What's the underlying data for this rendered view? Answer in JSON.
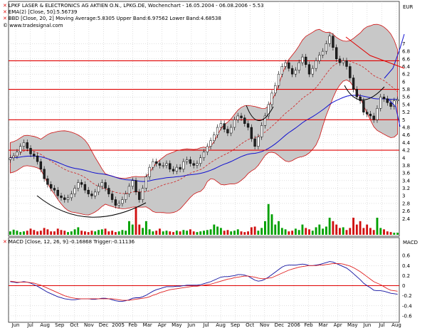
{
  "header": {
    "title": "LPKF LASER & ELECTRONICS AG AKTIEN O.N., LPKG.DE, Wochenchart - 16.05.2004 - 06.08.2006 - 5.53",
    "ema_label": "EMA(2) [Close, 50]:5.56739",
    "bbd_label": "BBD [Close, 20, 2] Moving Average:5.8305 Upper Band:6.97562 Lower Band:4.68538",
    "site": "© www.tradesignal.com",
    "macd_label": "MACD [Close, 12, 26, 9]:-0.16868 Trigger:-0.11136",
    "price_unit": "EUR",
    "macd_unit": "MACD"
  },
  "colors": {
    "up": "#00a000",
    "down": "#d01010",
    "band_fill": "#c8c8c8",
    "ema": "#1010d0",
    "moving_average": "#d02020",
    "macd": "#1010a0",
    "trigger": "#e02020",
    "hline": "#e00000",
    "grid": "#c0c0c0"
  },
  "chart_data": [
    {
      "type": "candlestick",
      "title": "LPKF LASER & ELECTRONICS AG AKTIEN O.N., LPKG.DE, Wochenchart - 16.05.2004 - 06.08.2006 - 5.53",
      "ylabel": "EUR",
      "ylim": [
        2.2,
        7.4
      ],
      "y_ticks": [
        2.4,
        2.6,
        2.8,
        3,
        3.2,
        3.4,
        3.6,
        3.8,
        4,
        4.2,
        4.4,
        4.6,
        4.8,
        5,
        5.2,
        5.4,
        5.6,
        5.8,
        6,
        6.2,
        6.4,
        6.6,
        6.8,
        7
      ],
      "x_ticks": [
        "Jun",
        "Jul",
        "Aug",
        "Sep",
        "Oct",
        "Nov",
        "Dec",
        "2005",
        "Feb",
        "Mar",
        "Apr",
        "May",
        "Jun",
        "Jul",
        "Aug",
        "Sep",
        "Oct",
        "Nov",
        "Dec",
        "2006",
        "Feb",
        "Mar",
        "Apr",
        "May",
        "Jun",
        "Jul",
        "Aug"
      ],
      "grid": true,
      "close": [
        4.0,
        4.05,
        4.15,
        4.3,
        4.4,
        4.25,
        4.1,
        4.05,
        3.9,
        3.7,
        3.45,
        3.3,
        3.2,
        3.15,
        3.0,
        2.95,
        2.9,
        2.95,
        3.05,
        3.2,
        3.35,
        3.3,
        3.15,
        3.05,
        3.0,
        3.1,
        3.25,
        3.35,
        3.2,
        3.05,
        2.9,
        2.75,
        2.8,
        2.9,
        3.05,
        3.25,
        3.4,
        3.1,
        2.9,
        3.2,
        3.5,
        3.75,
        3.9,
        3.85,
        3.8,
        3.8,
        3.85,
        3.7,
        3.65,
        3.75,
        3.7,
        3.9,
        3.95,
        3.85,
        3.8,
        3.85,
        4.0,
        4.15,
        4.3,
        4.45,
        4.6,
        4.8,
        4.9,
        4.75,
        4.65,
        4.8,
        5.0,
        5.1,
        5.05,
        4.9,
        4.8,
        4.5,
        4.3,
        4.55,
        4.85,
        5.1,
        5.4,
        5.7,
        5.9,
        6.2,
        6.4,
        6.5,
        6.35,
        6.2,
        6.3,
        6.5,
        6.65,
        6.45,
        6.2,
        6.35,
        6.55,
        6.7,
        6.8,
        7.0,
        7.2,
        6.9,
        6.6,
        6.5,
        6.55,
        6.4,
        6.1,
        5.8,
        5.6,
        5.5,
        5.2,
        5.15,
        5.1,
        5.0,
        5.3,
        5.6,
        5.55,
        5.45,
        5.35,
        5.5,
        5.53
      ],
      "volume": [
        0.1,
        0.15,
        0.12,
        0.08,
        0.1,
        0.12,
        0.18,
        0.14,
        0.1,
        0.12,
        0.2,
        0.16,
        0.1,
        0.1,
        0.18,
        0.14,
        0.12,
        0.08,
        0.1,
        0.16,
        0.22,
        0.12,
        0.1,
        0.08,
        0.12,
        0.1,
        0.14,
        0.16,
        0.18,
        0.1,
        0.12,
        0.08,
        0.1,
        0.14,
        0.12,
        0.4,
        0.3,
        0.8,
        0.3,
        0.2,
        0.4,
        0.16,
        0.1,
        0.12,
        0.18,
        0.1,
        0.12,
        0.1,
        0.08,
        0.12,
        0.1,
        0.14,
        0.12,
        0.16,
        0.1,
        0.08,
        0.1,
        0.12,
        0.14,
        0.16,
        0.3,
        0.24,
        0.2,
        0.12,
        0.14,
        0.1,
        0.12,
        0.16,
        0.1,
        0.08,
        0.1,
        0.22,
        0.24,
        0.12,
        0.2,
        0.4,
        0.9,
        0.6,
        0.3,
        0.4,
        0.2,
        0.16,
        0.1,
        0.12,
        0.18,
        0.14,
        0.3,
        0.2,
        0.16,
        0.12,
        0.22,
        0.3,
        0.18,
        0.24,
        0.5,
        0.4,
        0.3,
        0.2,
        0.22,
        0.14,
        0.2,
        0.5,
        0.3,
        0.4,
        0.2,
        0.3,
        0.2,
        0.14,
        0.5,
        0.2,
        0.16,
        0.1,
        0.08,
        0.06,
        0.06
      ],
      "horizontal_lines": [
        6.55,
        5.8,
        5.0,
        4.2
      ]
    },
    {
      "type": "line",
      "title": "MACD [Close, 12, 26, 9]:-0.16868 Trigger:-0.11136",
      "ylabel": "MACD",
      "ylim": [
        -0.7,
        0.8
      ],
      "y_ticks": [
        -0.6,
        -0.4,
        -0.2,
        0,
        0.2,
        0.4,
        0.6
      ],
      "series": [
        {
          "name": "MACD",
          "values": [
            0.08,
            0.07,
            0.06,
            0.07,
            0.08,
            0.07,
            0.05,
            0.02,
            -0.01,
            -0.05,
            -0.09,
            -0.13,
            -0.16,
            -0.19,
            -0.22,
            -0.24,
            -0.26,
            -0.27,
            -0.28,
            -0.28,
            -0.27,
            -0.26,
            -0.26,
            -0.26,
            -0.27,
            -0.27,
            -0.26,
            -0.25,
            -0.25,
            -0.26,
            -0.28,
            -0.3,
            -0.31,
            -0.31,
            -0.3,
            -0.28,
            -0.25,
            -0.24,
            -0.24,
            -0.22,
            -0.19,
            -0.15,
            -0.11,
            -0.08,
            -0.06,
            -0.04,
            -0.02,
            -0.02,
            -0.02,
            -0.01,
            -0.01,
            0.0,
            0.01,
            0.01,
            0.01,
            0.01,
            0.02,
            0.04,
            0.06,
            0.08,
            0.11,
            0.14,
            0.17,
            0.18,
            0.18,
            0.19,
            0.2,
            0.22,
            0.22,
            0.21,
            0.19,
            0.15,
            0.11,
            0.09,
            0.1,
            0.13,
            0.17,
            0.22,
            0.27,
            0.32,
            0.37,
            0.4,
            0.41,
            0.41,
            0.41,
            0.42,
            0.43,
            0.42,
            0.4,
            0.4,
            0.41,
            0.42,
            0.44,
            0.46,
            0.48,
            0.47,
            0.44,
            0.41,
            0.38,
            0.35,
            0.3,
            0.24,
            0.18,
            0.12,
            0.05,
            0.0,
            -0.04,
            -0.09,
            -0.1,
            -0.1,
            -0.11,
            -0.13,
            -0.15,
            -0.16,
            -0.17
          ]
        },
        {
          "name": "Trigger",
          "values": [
            0.09,
            0.08,
            0.07,
            0.07,
            0.07,
            0.07,
            0.06,
            0.05,
            0.03,
            0.01,
            -0.02,
            -0.05,
            -0.08,
            -0.11,
            -0.14,
            -0.17,
            -0.2,
            -0.22,
            -0.24,
            -0.25,
            -0.26,
            -0.26,
            -0.26,
            -0.26,
            -0.26,
            -0.26,
            -0.26,
            -0.26,
            -0.26,
            -0.26,
            -0.26,
            -0.27,
            -0.28,
            -0.29,
            -0.29,
            -0.29,
            -0.28,
            -0.27,
            -0.26,
            -0.25,
            -0.24,
            -0.22,
            -0.19,
            -0.17,
            -0.14,
            -0.12,
            -0.1,
            -0.08,
            -0.07,
            -0.06,
            -0.05,
            -0.04,
            -0.03,
            -0.02,
            -0.01,
            -0.01,
            0.0,
            0.01,
            0.02,
            0.03,
            0.05,
            0.07,
            0.09,
            0.11,
            0.13,
            0.14,
            0.16,
            0.17,
            0.18,
            0.19,
            0.19,
            0.18,
            0.17,
            0.15,
            0.14,
            0.14,
            0.15,
            0.16,
            0.19,
            0.22,
            0.25,
            0.28,
            0.31,
            0.33,
            0.35,
            0.37,
            0.38,
            0.39,
            0.4,
            0.4,
            0.4,
            0.41,
            0.41,
            0.42,
            0.43,
            0.44,
            0.44,
            0.44,
            0.43,
            0.41,
            0.39,
            0.36,
            0.32,
            0.28,
            0.23,
            0.18,
            0.13,
            0.08,
            0.05,
            0.02,
            -0.02,
            -0.06,
            -0.09,
            -0.1,
            -0.11
          ]
        }
      ]
    }
  ]
}
